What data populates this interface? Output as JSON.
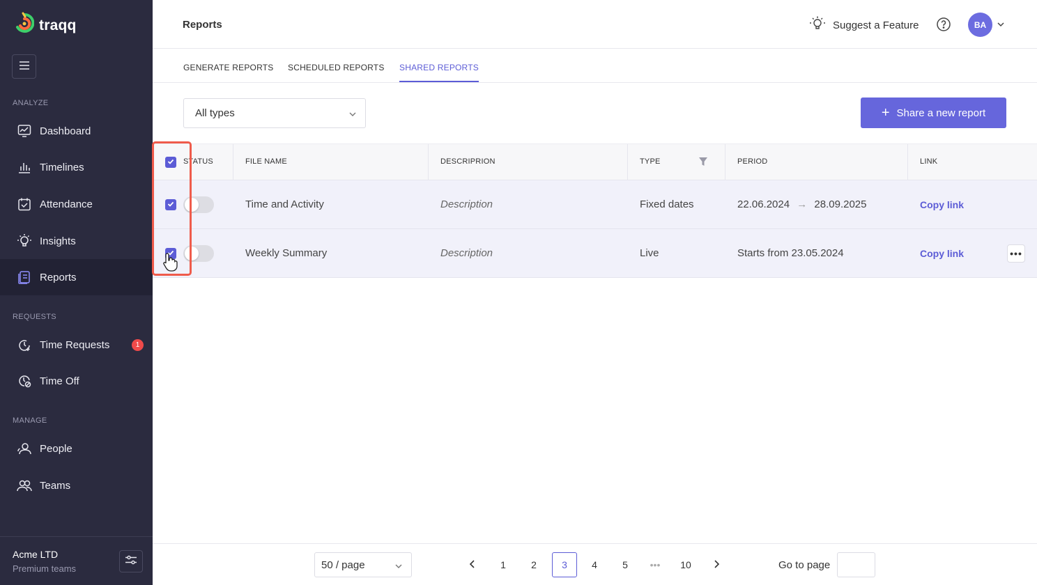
{
  "app": {
    "name": "traqq"
  },
  "sidebar": {
    "sections": [
      {
        "title": "ANALYZE"
      },
      {
        "title": "REQUESTS"
      },
      {
        "title": "MANAGE"
      }
    ],
    "items": [
      {
        "label": "Dashboard",
        "icon": "dashboard-icon"
      },
      {
        "label": "Timelines",
        "icon": "bar-chart-icon"
      },
      {
        "label": "Attendance",
        "icon": "calendar-check-icon"
      },
      {
        "label": "Insights",
        "icon": "lightbulb-icon"
      },
      {
        "label": "Reports",
        "icon": "report-icon",
        "active": true
      },
      {
        "label": "Time Requests",
        "icon": "time-request-icon",
        "badge": "1"
      },
      {
        "label": "Time Off",
        "icon": "time-off-icon"
      },
      {
        "label": "People",
        "icon": "people-icon"
      },
      {
        "label": "Teams",
        "icon": "teams-icon"
      }
    ],
    "org": {
      "name": "Acme LTD",
      "plan": "Premium teams"
    }
  },
  "header": {
    "title": "Reports",
    "suggest_label": "Suggest a Feature",
    "avatar_initials": "BA"
  },
  "tabs": [
    {
      "label": "GENERATE REPORTS",
      "active": false
    },
    {
      "label": "SCHEDULED REPORTS",
      "active": false
    },
    {
      "label": "SHARED REPORTS",
      "active": true
    }
  ],
  "toolbar": {
    "filter_value": "All types",
    "share_label": "Share a new report"
  },
  "table": {
    "columns": [
      "STATUS",
      "FILE NAME",
      "DESCRIPRION",
      "TYPE",
      "PERIOD",
      "LINK"
    ],
    "rows": [
      {
        "checked": true,
        "status_on": false,
        "file_name": "Time and Activity",
        "description": "Description",
        "type": "Fixed dates",
        "period_start": "22.06.2024",
        "period_arrow": "→",
        "period_end": "28.09.2025",
        "link": "Copy link"
      },
      {
        "checked": true,
        "status_on": false,
        "file_name": "Weekly Summary",
        "description": "Description",
        "type": "Live",
        "period": "Starts from 23.05.2024",
        "link": "Copy link",
        "more": "•••"
      }
    ]
  },
  "pagination": {
    "per_page": "50 / page",
    "pages": [
      "1",
      "2",
      "3",
      "4",
      "5",
      "•••",
      "10"
    ],
    "current": "3",
    "goto_label": "Go to page"
  },
  "colors": {
    "accent": "#5c5cd6",
    "sidebar": "#2b2b3f",
    "highlight": "#ef5b4b",
    "badge": "#ef4a4a"
  }
}
